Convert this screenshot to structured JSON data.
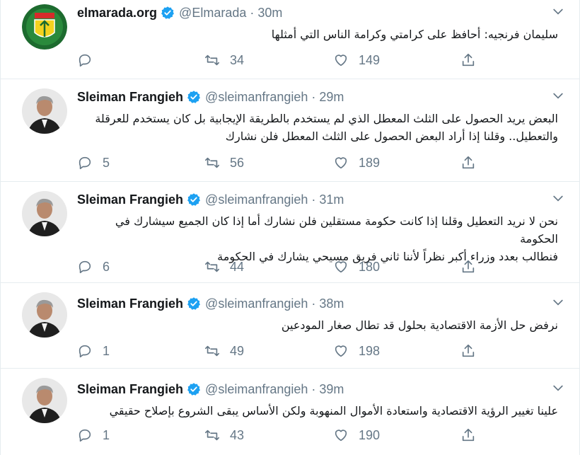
{
  "colors": {
    "text": "#14171a",
    "muted": "#657786",
    "verified": "#1da1f2",
    "border": "#e6ecf0"
  },
  "tweets": [
    {
      "name": "elmarada.org",
      "handle": "@Elmarada",
      "time": "30m",
      "lines": [
        "سليمان فرنجيه: أحافظ على كرامتي وكرامة الناس التي أمثلها"
      ],
      "replies": "",
      "retweets": "34",
      "likes": "149",
      "avatar_icon": "marada-logo-icon"
    },
    {
      "name": "Sleiman Frangieh",
      "handle": "@sleimanfrangieh",
      "time": "29m",
      "lines": [
        "البعض يريد الحصول على الثلث المعطل الذي لم يستخدم بالطريقة الإيجابية بل كان يستخدم للعرقلة",
        "والتعطيل.. وقلنا إذا أراد البعض الحصول على الثلث المعطل فلن نشارك"
      ],
      "replies": "5",
      "retweets": "56",
      "likes": "189",
      "avatar_icon": "profile-photo-icon"
    },
    {
      "name": "Sleiman Frangieh",
      "handle": "@sleimanfrangieh",
      "time": "31m",
      "lines": [
        "نحن لا نريد التعطيل وقلنا إذا كانت حكومة مستقلين فلن نشارك أما إذا كان الجميع سيشارك في الحكومة",
        "فنطالب بعدد وزراء أكبر نظراً لأننا ثاني فريق مسيحي يشارك في الحكومة"
      ],
      "replies": "6",
      "retweets": "44",
      "likes": "180",
      "avatar_icon": "profile-photo-icon"
    },
    {
      "name": "Sleiman Frangieh",
      "handle": "@sleimanfrangieh",
      "time": "38m",
      "lines": [
        "نرفض حل الأزمة الاقتصادية بحلول قد تطال صغار المودعين"
      ],
      "replies": "1",
      "retweets": "49",
      "likes": "198",
      "avatar_icon": "profile-photo-icon"
    },
    {
      "name": "Sleiman Frangieh",
      "handle": "@sleimanfrangieh",
      "time": "39m",
      "lines": [
        "علينا تغيير الرؤية الاقتصادية واستعادة الأموال المنهوبة ولكن الأساس يبقى الشروع بإصلاح حقيقي"
      ],
      "replies": "1",
      "retweets": "43",
      "likes": "190",
      "avatar_icon": "profile-photo-icon"
    }
  ]
}
